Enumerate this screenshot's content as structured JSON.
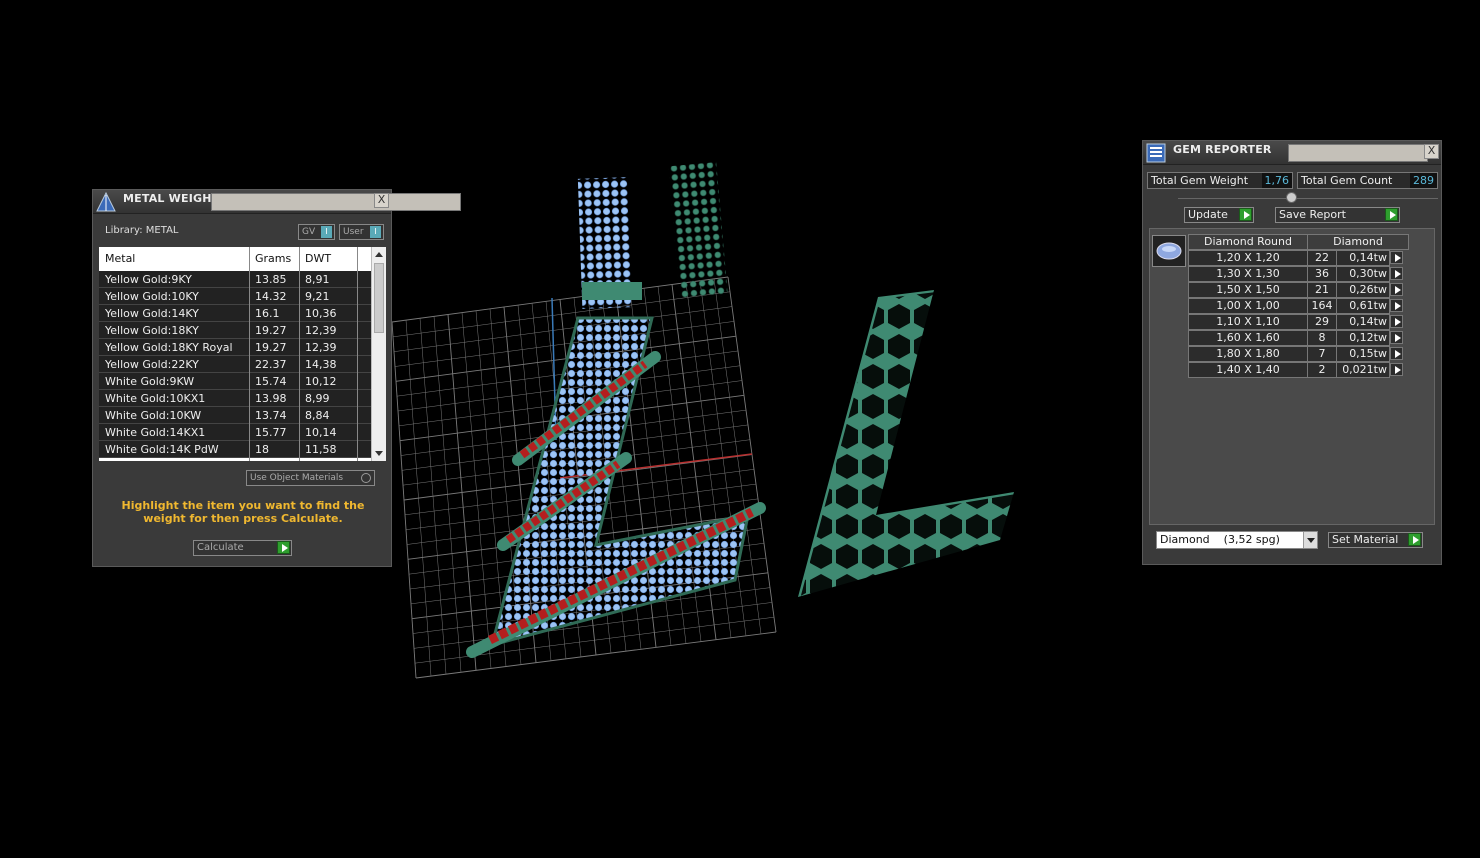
{
  "metal_weights": {
    "title": "METAL WEIGHTS",
    "close": "X",
    "library_label": "Library: METAL",
    "toggle_gv": "GV",
    "toggle_user": "User",
    "toggle_on": "I",
    "columns": [
      "Metal",
      "Grams",
      "DWT"
    ],
    "rows": [
      [
        "Yellow Gold:9KY",
        "13.85",
        "8,91"
      ],
      [
        "Yellow Gold:10KY",
        "14.32",
        "9,21"
      ],
      [
        "Yellow Gold:14KY",
        "16.1",
        "10,36"
      ],
      [
        "Yellow Gold:18KY",
        "19.27",
        "12,39"
      ],
      [
        "Yellow Gold:18KY Royal",
        "19.27",
        "12,39"
      ],
      [
        "Yellow Gold:22KY",
        "22.37",
        "14,38"
      ],
      [
        "White Gold:9KW",
        "15.74",
        "10,12"
      ],
      [
        "White Gold:10KX1",
        "13.98",
        "8,99"
      ],
      [
        "White Gold:10KW",
        "13.74",
        "8,84"
      ],
      [
        "White Gold:14KX1",
        "15.77",
        "10,14"
      ],
      [
        "White Gold:14K PdW",
        "18",
        "11,58"
      ]
    ],
    "use_object_materials": "Use Object Materials",
    "hint": "Highlight the item you want to find the weight for then press Calculate.",
    "calculate_label": "Calculate"
  },
  "gem_reporter": {
    "title": "GEM REPORTER",
    "close": "X",
    "total_weight_label": "Total Gem Weight",
    "total_weight_value": "1,76",
    "total_count_label": "Total Gem Count",
    "total_count_value": "289",
    "update_label": "Update",
    "save_report_label": "Save Report",
    "header_shape": "Diamond Round",
    "header_material": "Diamond",
    "gems": [
      [
        "1,20 X 1,20",
        "22",
        "0,14tw"
      ],
      [
        "1,30 X 1,30",
        "36",
        "0,30tw"
      ],
      [
        "1,50 X 1,50",
        "21",
        "0,26tw"
      ],
      [
        "1,00 X 1,00",
        "164",
        "0,61tw"
      ],
      [
        "1,10 X 1,10",
        "29",
        "0,14tw"
      ],
      [
        "1,60 X 1,60",
        "8",
        "0,12tw"
      ],
      [
        "1,80 X 1,80",
        "7",
        "0,15tw"
      ],
      [
        "1,40 X 1,40",
        "2",
        "0,021tw"
      ]
    ],
    "material_select": "Diamond    (3,52 spg)",
    "set_material_label": "Set Material"
  },
  "colors": {
    "background": "#000000",
    "grid": "#7a7a7a",
    "metal_green": "#3f8a72",
    "gem_blue": "#8fb8f0",
    "ruby_red": "#b41e1e",
    "accent_cyan": "#5ab8d8",
    "hint_yellow": "#f0b830",
    "button_green": "#2e9e2e"
  }
}
